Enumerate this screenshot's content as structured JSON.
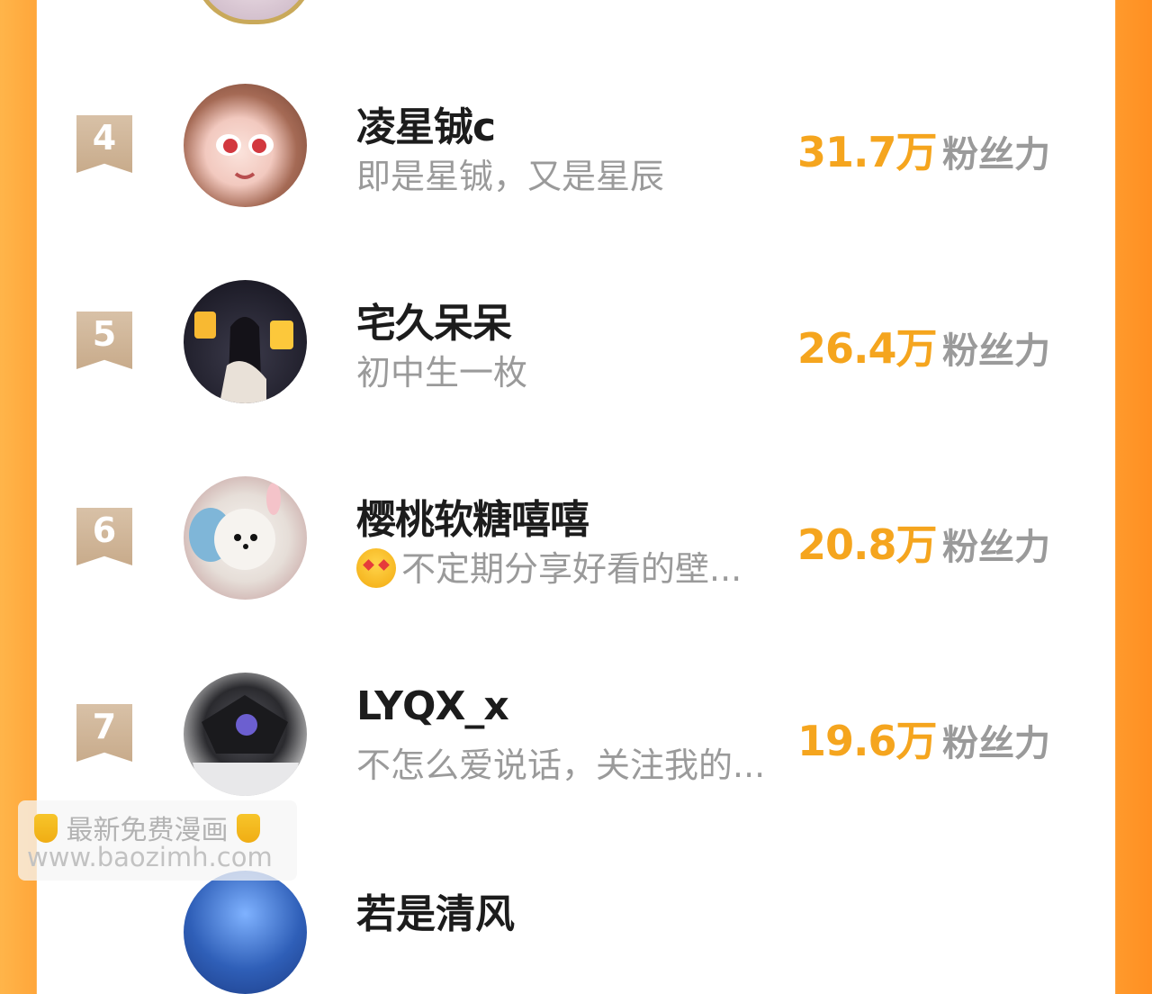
{
  "list": {
    "fans_unit": "粉丝力",
    "rows": [
      {
        "rank": "4",
        "name": "凌星铖c",
        "bio": "即是星铖，又是星辰",
        "fans": "31.7万"
      },
      {
        "rank": "5",
        "name": "宅久呆呆",
        "bio": "初中生一枚",
        "fans": "26.4万"
      },
      {
        "rank": "6",
        "name": "樱桃软糖嘻嘻",
        "bio": "不定期分享好看的壁...",
        "fans": "20.8万"
      },
      {
        "rank": "7",
        "name": "LYQX_x",
        "bio": "不怎么爱说话，关注我的...",
        "fans": "19.6万"
      }
    ],
    "partial_next_name": "若是清风"
  },
  "watermark": {
    "line1": "最新免费漫画",
    "line2": "www.baozimh.com"
  },
  "colors": {
    "accent": "#f5a51e",
    "rank_badge": "#c8ab8b",
    "bio_text": "#9a9a9a",
    "border_orange": "#ffa63a"
  },
  "icons": {
    "emoji": "smiling-face-with-hearts-icon",
    "watermark_hand": "backhand-index-pointing-down-icon"
  }
}
